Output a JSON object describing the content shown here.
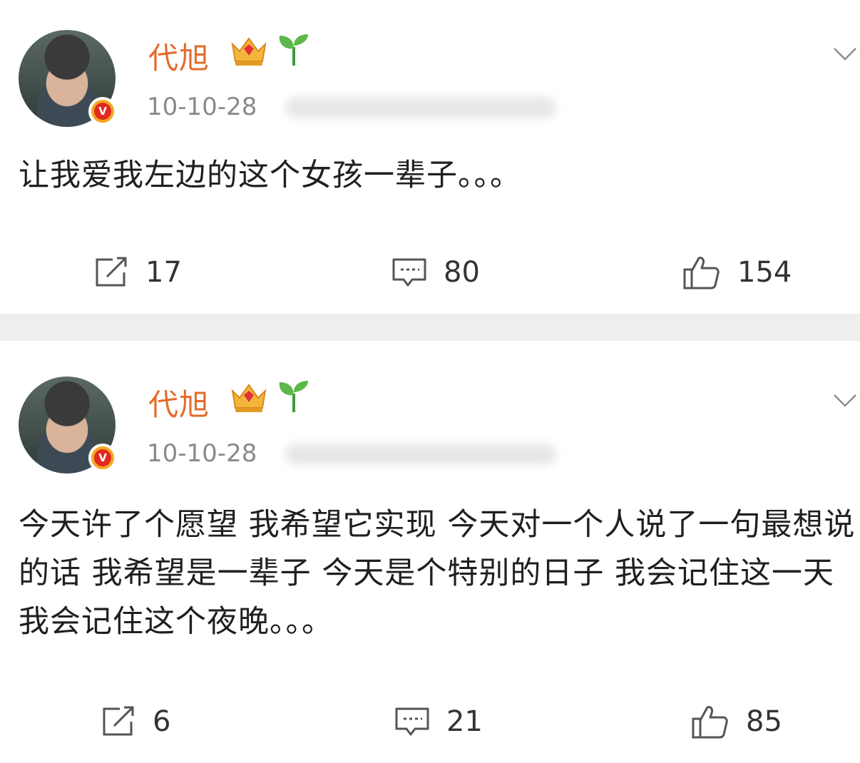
{
  "posts": [
    {
      "username": "代旭",
      "timestamp": "10-10-28",
      "content": "让我爱我左边的这个女孩一辈子。。。",
      "repost_count": "17",
      "comment_count": "80",
      "like_count": "154"
    },
    {
      "username": "代旭",
      "timestamp": "10-10-28",
      "content": "今天许了个愿望 我希望它实现 今天对一个人说了一句最想说的话 我希望是一辈子 今天是个特别的日子 我会记住这一天 我会记住这个夜晚。。。",
      "repost_count": "6",
      "comment_count": "21",
      "like_count": "85"
    }
  ],
  "badge_letter": "V",
  "icons": {
    "verified": "verified-v-icon",
    "crown": "crown-icon",
    "sprout": "sprout-icon",
    "menu": "chevron-down-icon",
    "repost": "repost-icon",
    "comment": "comment-icon",
    "like": "thumbs-up-icon"
  },
  "colors": {
    "username": "#e46b2a",
    "timestamp": "#8a8a8a",
    "separator": "#eeeeee",
    "badge_outer": "#f5a623",
    "badge_inner": "#e02a1f"
  }
}
